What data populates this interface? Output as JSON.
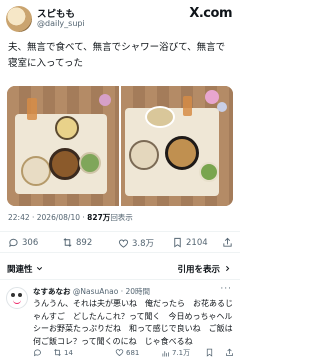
{
  "post": {
    "author_name": "スピもも",
    "author_handle": "@daily_supi",
    "brand": "X.com",
    "text": "夫、無言で食べて、無言でシャワー浴びて、無言で寝室に入ってった",
    "timestamp": "22:42 · 2026/08/10 · ",
    "views_count": "827万",
    "views_label": "回表示"
  },
  "stats": {
    "replies": "306",
    "reposts": "892",
    "likes": "3.8万",
    "bookmarks": "2104"
  },
  "sort": {
    "label": "関連性",
    "action": "引用を表示",
    "chevron": "chevron-down-icon",
    "arrow": "chevron-right-icon"
  },
  "reply": {
    "name": "なすあなお",
    "handle": "@NasuAnao",
    "time": "· 20時間",
    "text": "うんうん、それは夫が悪いね　俺だったら　お花あるじゃんすご　どしたんこれ？って聞く　今日めっちゃヘルシーお野菜たっぷりだね　和って感じで良いね　ご飯は何ご飯コレ？って聞くのにね　じゃ食べるね",
    "stats": {
      "replies": "14",
      "reposts": "",
      "likes": "681",
      "views": "7.1万"
    }
  },
  "colors": {
    "muted": "#536471",
    "text": "#0f1419",
    "divider": "#eff3f4"
  }
}
